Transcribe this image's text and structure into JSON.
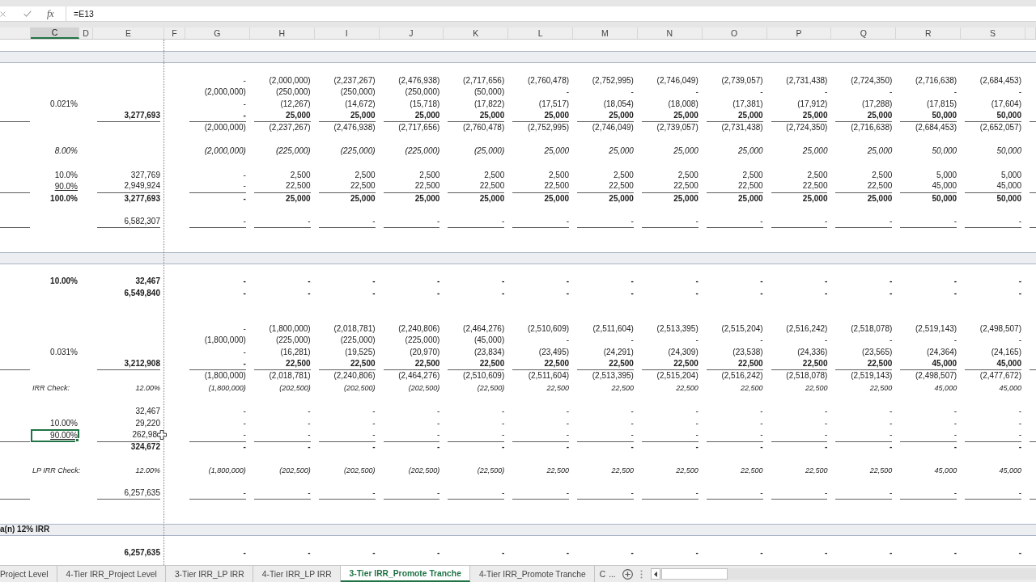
{
  "formula_bar": {
    "function_label": "fx",
    "value": "=E13"
  },
  "columns": [
    {
      "label": "C",
      "selected": true
    },
    {
      "label": "D",
      "selected": false
    },
    {
      "label": "E",
      "selected": false
    },
    {
      "label": "F",
      "selected": false
    },
    {
      "label": "G",
      "selected": false
    },
    {
      "label": "H",
      "selected": false
    },
    {
      "label": "I",
      "selected": false
    },
    {
      "label": "J",
      "selected": false
    },
    {
      "label": "K",
      "selected": false
    },
    {
      "label": "L",
      "selected": false
    },
    {
      "label": "M",
      "selected": false
    },
    {
      "label": "N",
      "selected": false
    },
    {
      "label": "O",
      "selected": false
    },
    {
      "label": "P",
      "selected": false
    },
    {
      "label": "Q",
      "selected": false
    },
    {
      "label": "R",
      "selected": false
    },
    {
      "label": "S",
      "selected": false
    }
  ],
  "rows": [
    {
      "kind": "blank"
    },
    {
      "kind": "band"
    },
    {
      "kind": "blank"
    },
    {
      "kind": "line",
      "ruled": false,
      "values": [
        "-",
        "(2,000,000)",
        "(2,237,267)",
        "(2,476,938)",
        "(2,717,656)",
        "(2,760,478)",
        "(2,752,995)",
        "(2,746,049)",
        "(2,739,057)",
        "(2,731,438)",
        "(2,724,350)",
        "(2,716,638)",
        "(2,684,453)"
      ]
    },
    {
      "kind": "line",
      "ruled": false,
      "values": [
        "(2,000,000)",
        "(250,000)",
        "(250,000)",
        "(250,000)",
        "(50,000)",
        "-",
        "-",
        "-",
        "-",
        "-",
        "-",
        "-",
        "-"
      ]
    },
    {
      "kind": "line",
      "ruled": false,
      "c": {
        "text": "0.021%",
        "selected": false
      },
      "values": [
        "-",
        "(12,267)",
        "(14,672)",
        "(15,718)",
        "(17,822)",
        "(17,517)",
        "(18,054)",
        "(18,008)",
        "(17,381)",
        "(17,912)",
        "(17,288)",
        "(17,815)",
        "(17,604)"
      ]
    },
    {
      "kind": "total",
      "ruled": true,
      "e": "3,277,693",
      "values": [
        "-",
        "25,000",
        "25,000",
        "25,000",
        "25,000",
        "25,000",
        "25,000",
        "25,000",
        "25,000",
        "25,000",
        "25,000",
        "50,000",
        "50,000"
      ]
    },
    {
      "kind": "line",
      "ruled": false,
      "values": [
        "(2,000,000)",
        "(2,237,267)",
        "(2,476,938)",
        "(2,717,656)",
        "(2,760,478)",
        "(2,752,995)",
        "(2,746,049)",
        "(2,739,057)",
        "(2,731,438)",
        "(2,724,350)",
        "(2,716,638)",
        "(2,684,453)",
        "(2,652,057)"
      ]
    },
    {
      "kind": "blank"
    },
    {
      "kind": "memo",
      "ruled": false,
      "c": {
        "text": "8.00%",
        "selected": false
      },
      "values": [
        "(2,000,000)",
        "(225,000)",
        "(225,000)",
        "(225,000)",
        "(25,000)",
        "25,000",
        "25,000",
        "25,000",
        "25,000",
        "25,000",
        "25,000",
        "50,000",
        "50,000"
      ]
    },
    {
      "kind": "blank"
    },
    {
      "kind": "line",
      "ruled": false,
      "c": {
        "text": "10.0%",
        "selected": false
      },
      "e": "327,769",
      "values": [
        "-",
        "2,500",
        "2,500",
        "2,500",
        "2,500",
        "2,500",
        "2,500",
        "2,500",
        "2,500",
        "2,500",
        "2,500",
        "5,000",
        "5,000"
      ]
    },
    {
      "kind": "line",
      "ruled": true,
      "c": {
        "text": "90.0%",
        "selected": false
      },
      "e": "2,949,924",
      "values": [
        "-",
        "22,500",
        "22,500",
        "22,500",
        "22,500",
        "22,500",
        "22,500",
        "22,500",
        "22,500",
        "22,500",
        "22,500",
        "45,000",
        "45,000"
      ]
    },
    {
      "kind": "total",
      "ruled": false,
      "c": {
        "text": "100.0%",
        "selected": false
      },
      "e": "3,277,693",
      "values": [
        "-",
        "25,000",
        "25,000",
        "25,000",
        "25,000",
        "25,000",
        "25,000",
        "25,000",
        "25,000",
        "25,000",
        "25,000",
        "50,000",
        "50,000"
      ]
    },
    {
      "kind": "blank"
    },
    {
      "kind": "line",
      "ruled": true,
      "e": "6,582,307",
      "values": [
        "-",
        "-",
        "-",
        "-",
        "-",
        "-",
        "-",
        "-",
        "-",
        "-",
        "-",
        "-",
        "-"
      ]
    },
    {
      "kind": "blank"
    },
    {
      "kind": "blank"
    },
    {
      "kind": "band"
    },
    {
      "kind": "blank"
    },
    {
      "kind": "total",
      "ruled": false,
      "c": {
        "text": "10.00%",
        "selected": false
      },
      "e": "32,467",
      "values": [
        "-",
        "-",
        "-",
        "-",
        "-",
        "-",
        "-",
        "-",
        "-",
        "-",
        "-",
        "-",
        "-"
      ]
    },
    {
      "kind": "total",
      "ruled": false,
      "e": "6,549,840",
      "values": [
        "-",
        "-",
        "-",
        "-",
        "-",
        "-",
        "-",
        "-",
        "-",
        "-",
        "-",
        "-",
        "-"
      ]
    },
    {
      "kind": "blank"
    },
    {
      "kind": "blank"
    },
    {
      "kind": "line",
      "ruled": false,
      "values": [
        "-",
        "(1,800,000)",
        "(2,018,781)",
        "(2,240,806)",
        "(2,464,276)",
        "(2,510,609)",
        "(2,511,604)",
        "(2,513,395)",
        "(2,515,204)",
        "(2,516,242)",
        "(2,518,078)",
        "(2,519,143)",
        "(2,498,507)"
      ]
    },
    {
      "kind": "line",
      "ruled": false,
      "values": [
        "(1,800,000)",
        "(225,000)",
        "(225,000)",
        "(225,000)",
        "(45,000)",
        "-",
        "-",
        "-",
        "-",
        "-",
        "-",
        "-",
        "-"
      ]
    },
    {
      "kind": "line",
      "ruled": false,
      "c": {
        "text": "0.031%",
        "selected": false
      },
      "values": [
        "-",
        "(16,281)",
        "(19,525)",
        "(20,970)",
        "(23,834)",
        "(23,495)",
        "(24,291)",
        "(24,309)",
        "(23,538)",
        "(24,336)",
        "(23,565)",
        "(24,364)",
        "(24,165)"
      ]
    },
    {
      "kind": "total",
      "ruled": true,
      "e": "3,212,908",
      "values": [
        "-",
        "22,500",
        "22,500",
        "22,500",
        "22,500",
        "22,500",
        "22,500",
        "22,500",
        "22,500",
        "22,500",
        "22,500",
        "45,000",
        "45,000"
      ]
    },
    {
      "kind": "line",
      "ruled": false,
      "values": [
        "(1,800,000)",
        "(2,018,781)",
        "(2,240,806)",
        "(2,464,276)",
        "(2,510,609)",
        "(2,511,604)",
        "(2,513,395)",
        "(2,515,204)",
        "(2,516,242)",
        "(2,518,078)",
        "(2,519,143)",
        "(2,498,507)",
        "(2,477,672)"
      ]
    },
    {
      "kind": "check",
      "ruled": false,
      "label": "IRR Check:",
      "e": "12.00%",
      "values": [
        "(1,800,000)",
        "(202,500)",
        "(202,500)",
        "(202,500)",
        "(22,500)",
        "22,500",
        "22,500",
        "22,500",
        "22,500",
        "22,500",
        "22,500",
        "45,000",
        "45,000"
      ]
    },
    {
      "kind": "blank"
    },
    {
      "kind": "line",
      "ruled": false,
      "e": "32,467",
      "values": [
        "-",
        "-",
        "-",
        "-",
        "-",
        "-",
        "-",
        "-",
        "-",
        "-",
        "-",
        "-",
        "-"
      ]
    },
    {
      "kind": "line",
      "ruled": false,
      "c": {
        "text": "10.00%",
        "selected": false
      },
      "e": "29,220",
      "values": [
        "-",
        "-",
        "-",
        "-",
        "-",
        "-",
        "-",
        "-",
        "-",
        "-",
        "-",
        "-",
        "-"
      ]
    },
    {
      "kind": "line",
      "ruled": true,
      "c": {
        "text": "90.00%",
        "selected": true
      },
      "e": "262,98",
      "values": [
        "-",
        "-",
        "-",
        "-",
        "-",
        "-",
        "-",
        "-",
        "-",
        "-",
        "-",
        "-",
        "-"
      ]
    },
    {
      "kind": "total",
      "ruled": false,
      "e": "324,672",
      "values": [
        "-",
        "-",
        "-",
        "-",
        "-",
        "-",
        "-",
        "-",
        "-",
        "-",
        "-",
        "-",
        "-"
      ]
    },
    {
      "kind": "blank"
    },
    {
      "kind": "check",
      "ruled": false,
      "label": "LP IRR Check:",
      "e": "12.00%",
      "values": [
        "(1,800,000)",
        "(202,500)",
        "(202,500)",
        "(202,500)",
        "(22,500)",
        "22,500",
        "22,500",
        "22,500",
        "22,500",
        "22,500",
        "22,500",
        "45,000",
        "45,000"
      ]
    },
    {
      "kind": "blank"
    },
    {
      "kind": "line",
      "ruled": true,
      "e": "6,257,635",
      "values": [
        "-",
        "-",
        "-",
        "-",
        "-",
        "-",
        "-",
        "-",
        "-",
        "-",
        "-",
        "-",
        "-"
      ]
    },
    {
      "kind": "blank"
    },
    {
      "kind": "blank"
    },
    {
      "kind": "band",
      "title": "a(n) 12% IRR"
    },
    {
      "kind": "blank"
    },
    {
      "kind": "total",
      "ruled": false,
      "e": "6,257,635",
      "values": [
        "-",
        "-",
        "-",
        "-",
        "-",
        "-",
        "-",
        "-",
        "-",
        "-",
        "-",
        "-",
        "-"
      ]
    }
  ],
  "sheet_tabs": [
    {
      "label": "Project Level",
      "selected": false
    },
    {
      "label": "4-Tier IRR_Project Level",
      "selected": false
    },
    {
      "label": "3-Tier IRR_LP IRR",
      "selected": false
    },
    {
      "label": "4-Tier IRR_LP IRR",
      "selected": false
    },
    {
      "label": "3-Tier IRR_Promote Tranche",
      "selected": true
    },
    {
      "label": "4-Tier IRR_Promote Tranche",
      "selected": false
    },
    {
      "label": "C",
      "selected": false
    }
  ],
  "more_tabs": "..."
}
